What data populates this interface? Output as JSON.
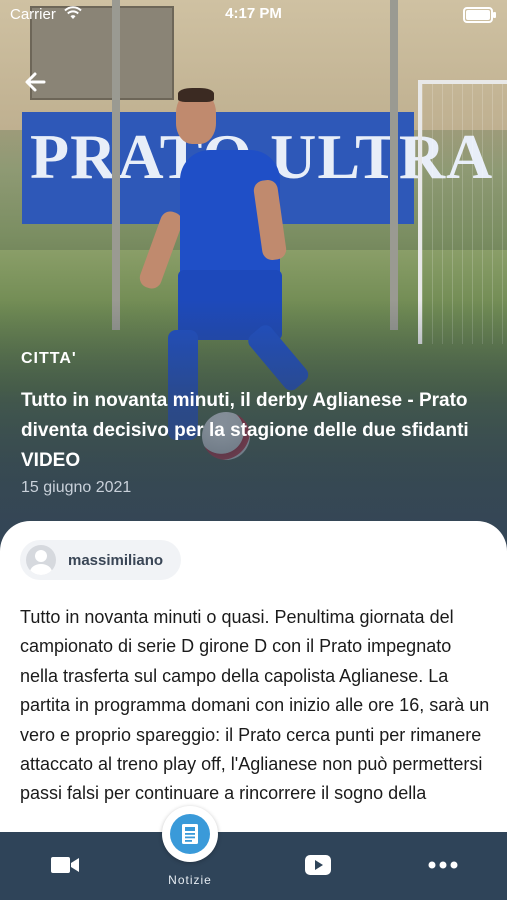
{
  "status_bar": {
    "carrier": "Carrier",
    "time": "4:17 PM"
  },
  "hero": {
    "banner_text": "PRATO ULTRA"
  },
  "article": {
    "category": "CITTA'",
    "title": "Tutto in novanta minuti, il derby Aglianese - Prato diventa decisivo per la stagione delle due sfidanti VIDEO",
    "date": "15 giugno 2021",
    "author": "massimiliano",
    "body": "Tutto in novanta minuti o quasi. Penultima giornata del campionato di serie D girone D con il Prato impegnato nella trasferta sul campo della capolista Aglianese. La partita in programma domani con inizio alle ore 16, sarà un vero e proprio spareggio: il Prato cerca punti per rimanere attaccato al treno play off, l'Aglianese non può permettersi passi falsi per continuare a rincorrere il sogno della"
  },
  "tab_bar": {
    "items": [
      {
        "name": "video",
        "icon": "video-camera-icon"
      },
      {
        "name": "notizie",
        "label": "Notizie",
        "icon": "newspaper-icon"
      },
      {
        "name": "youtube",
        "icon": "play-button-icon"
      },
      {
        "name": "more",
        "icon": "more-dots-icon"
      }
    ]
  },
  "colors": {
    "tab_bar": "#2f4459",
    "accent": "#3a9ad9"
  }
}
